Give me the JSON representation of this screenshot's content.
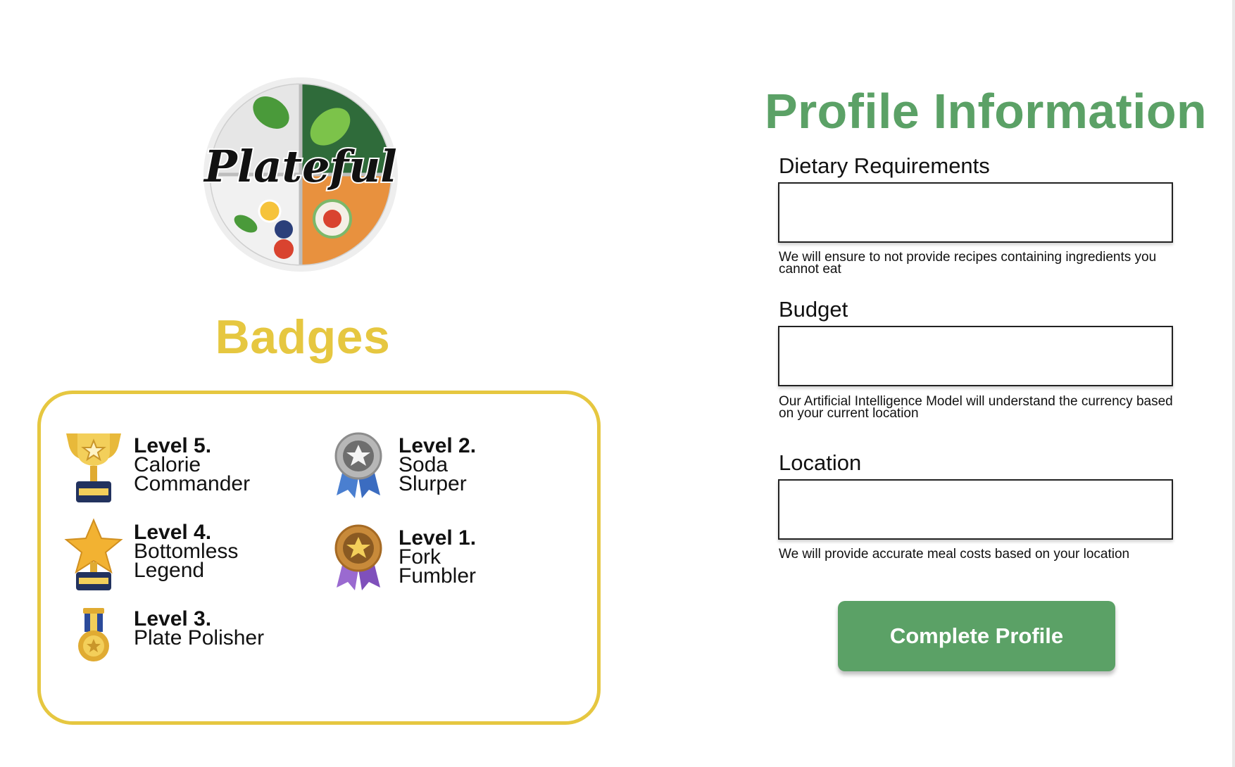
{
  "logo": {
    "text": "Plateful"
  },
  "badges": {
    "title": "Badges",
    "items": [
      {
        "level": "Level 5.",
        "name": "Calorie\nCommander",
        "icon": "gold-trophy-icon"
      },
      {
        "level": "Level 4.",
        "name": "Bottomless\nLegend",
        "icon": "star-trophy-icon"
      },
      {
        "level": "Level 3.",
        "name": "Plate Polisher",
        "icon": "blue-ribbon-medal-icon"
      },
      {
        "level": "Level 2.",
        "name": "Soda\nSlurper",
        "icon": "silver-medal-icon"
      },
      {
        "level": "Level 1.",
        "name": "Fork\nFumbler",
        "icon": "bronze-medal-icon"
      }
    ]
  },
  "profile": {
    "title": "Profile Information",
    "fields": [
      {
        "label": "Dietary Requirements",
        "value": "",
        "help": "We will ensure to not provide recipes containing ingredients you cannot eat"
      },
      {
        "label": "Budget",
        "value": "",
        "help": "Our Artificial  Intelligence Model will understand the currency based on your current location"
      },
      {
        "label": "Location",
        "value": "",
        "help": "We will provide accurate meal costs based on your location"
      }
    ],
    "submit_label": "Complete Profile"
  },
  "colors": {
    "brand_green": "#5ba166",
    "badge_yellow": "#e6c740"
  }
}
